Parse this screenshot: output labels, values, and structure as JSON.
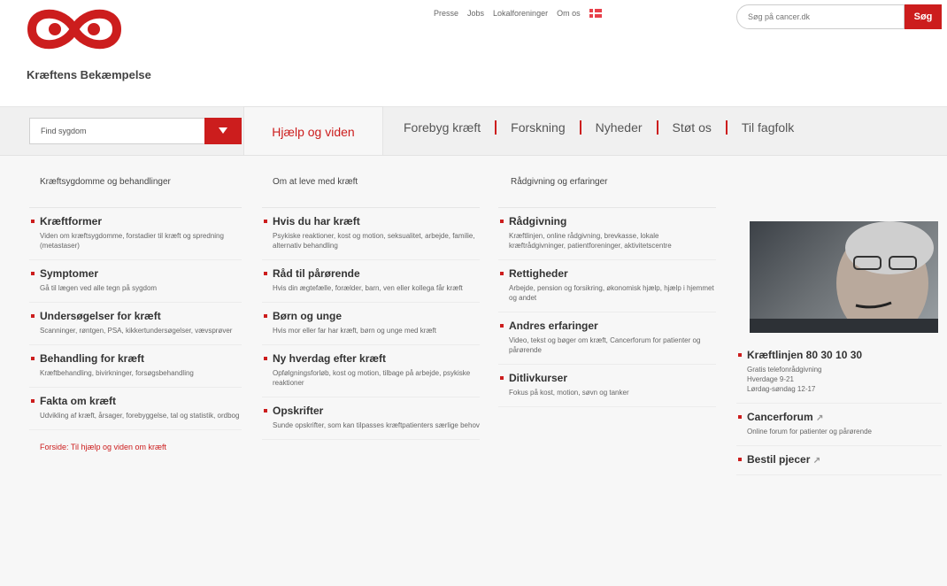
{
  "brand": {
    "name": "Kræftens Bekæmpelse",
    "logo_icon": "kb-logo-icon",
    "color": "#cc1d1d"
  },
  "top_links": [
    "Presse",
    "Jobs",
    "Lokalforeninger",
    "Om os"
  ],
  "search": {
    "placeholder": "Søg på cancer.dk",
    "button_label": "Søg"
  },
  "nav": {
    "select_placeholder": "Find sygdom",
    "active_tab": "Hjælp og viden",
    "tabs": [
      "Forebyg kræft",
      "Forskning",
      "Nyheder",
      "Støt os",
      "Til fagfolk"
    ]
  },
  "columns": [
    {
      "heading": "Kræftsygdomme og behandlinger",
      "items": [
        {
          "title": "Kræftformer",
          "desc": "Viden om kræftsygdomme, forstadier til kræft og spredning (metastaser)"
        },
        {
          "title": "Symptomer",
          "desc": "Gå til lægen ved alle tegn på sygdom"
        },
        {
          "title": "Undersøgelser for kræft",
          "desc": "Scanninger, røntgen, PSA, kikkertundersøgelser, vævsprøver"
        },
        {
          "title": "Behandling for kræft",
          "desc": "Kræftbehandling, bivirkninger, forsøgsbehandling"
        },
        {
          "title": "Fakta om kræft",
          "desc": "Udvikling af kræft, årsager, forebyggelse, tal og statistik, ordbog"
        }
      ],
      "link": "Forside: Til hjælp og viden om kræft"
    },
    {
      "heading": "Om at leve med kræft",
      "items": [
        {
          "title": "Hvis du har kræft",
          "desc": "Psykiske reaktioner, kost og motion, seksualitet, arbejde, familie, alternativ behandling"
        },
        {
          "title": "Råd til pårørende",
          "desc": "Hvis din ægtefælle, forælder, barn, ven eller kollega får kræft"
        },
        {
          "title": "Børn og unge",
          "desc": "Hvis mor eller far har kræft, børn og unge med kræft"
        },
        {
          "title": "Ny hverdag efter kræft",
          "desc": "Opfølgningsforløb, kost og motion, tilbage på arbejde, psykiske reaktioner"
        },
        {
          "title": "Opskrifter",
          "desc": "Sunde opskrifter, som kan tilpasses kræftpatienters særlige behov"
        }
      ]
    },
    {
      "heading": "Rådgivning og erfaringer",
      "items": [
        {
          "title": "Rådgivning",
          "desc": "Kræftlinjen, online rådgivning, brevkasse, lokale kræftrådgivninger, patientforeninger, aktivitetscentre"
        },
        {
          "title": "Rettigheder",
          "desc": "Arbejde, pension og forsikring, økonomisk hjælp, hjælp i hjemmet og andet"
        },
        {
          "title": "Andres erfaringer",
          "desc": "Video, tekst og bøger om kræft, Cancerforum for patienter og pårørende"
        },
        {
          "title": "Ditlivkurser",
          "desc": "Fokus på kost, motion, søvn og tanker"
        }
      ]
    },
    {
      "items": [
        {
          "title": "Kræftlinjen 80 30 10 30",
          "desc": "Gratis telefonrådgivning",
          "desc2": "Hverdage 9-21",
          "desc3": "Lørdag-søndag 12-17"
        },
        {
          "title": "Cancerforum",
          "desc": "Online forum for patienter og pårørende",
          "external": true
        },
        {
          "title": "Bestil pjecer",
          "external": true
        }
      ]
    }
  ],
  "photo_alt": "counselor-with-headset-photo"
}
